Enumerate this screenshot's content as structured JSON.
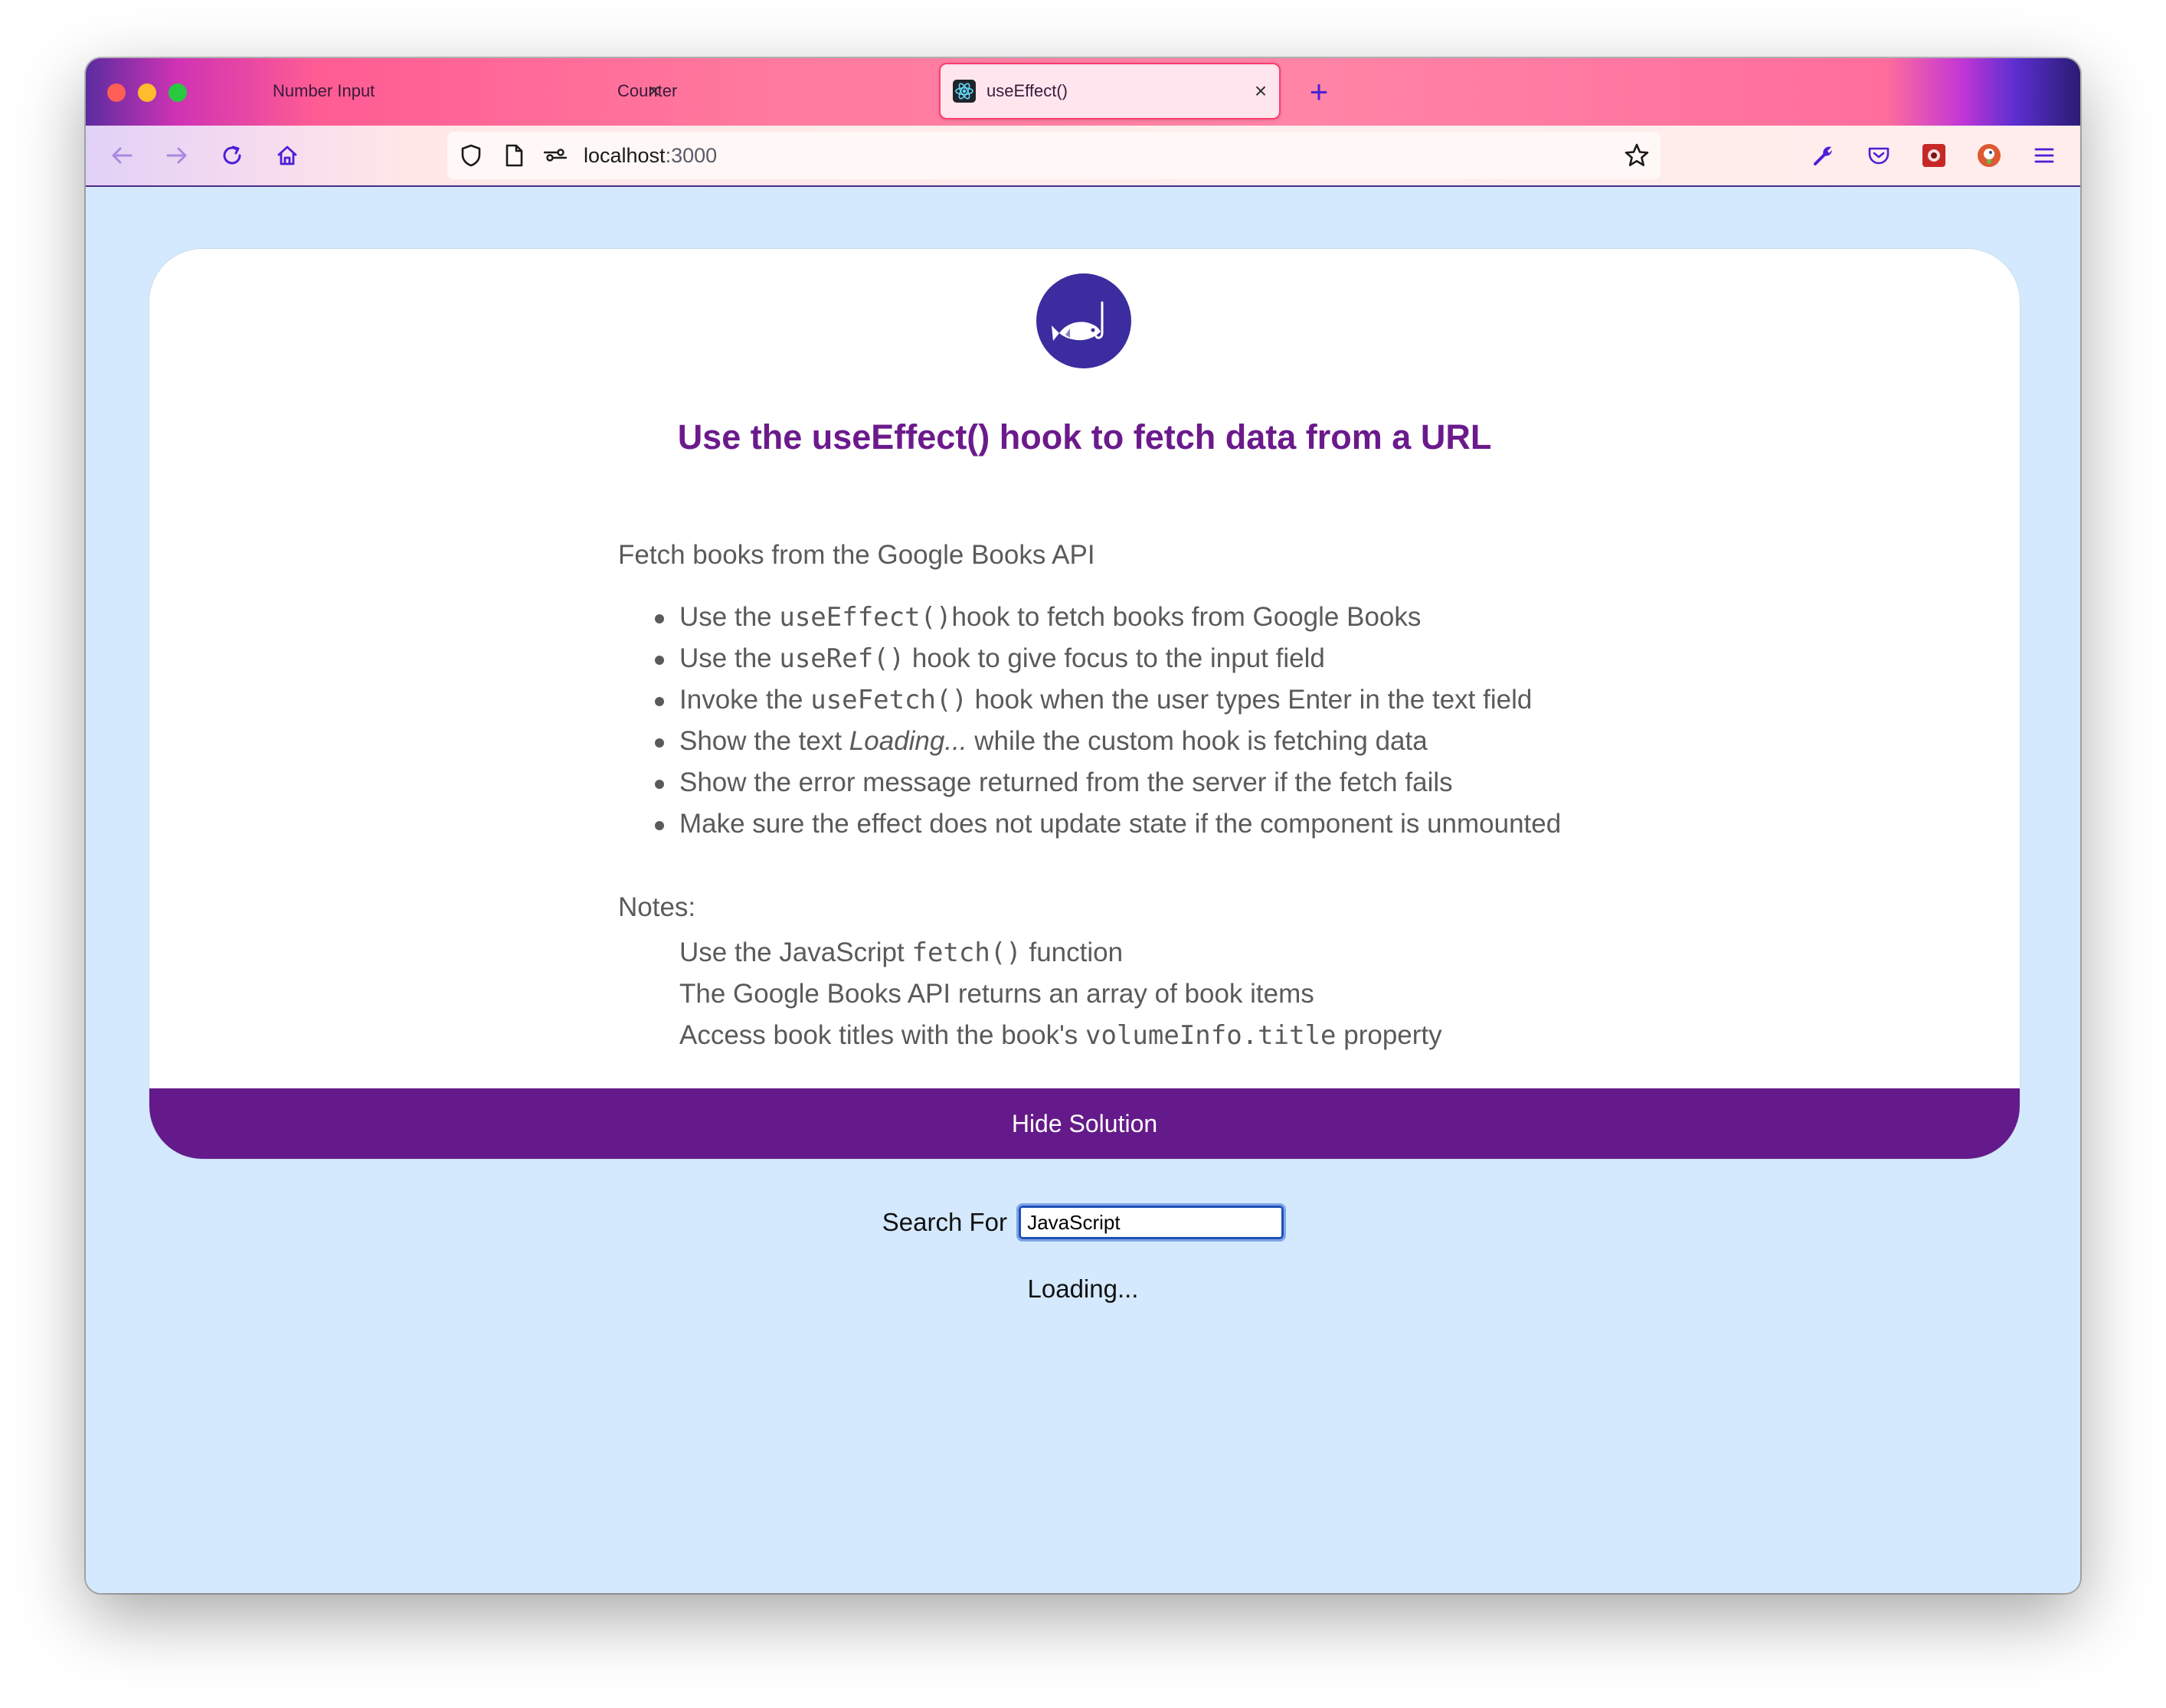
{
  "browser": {
    "tabs": [
      {
        "label": "Number Input",
        "active": false
      },
      {
        "label": "Counter",
        "active": false
      },
      {
        "label": "useEffect()",
        "active": true
      }
    ],
    "url_host": "localhost",
    "url_port": ":3000"
  },
  "page": {
    "title": "Use the useEffect() hook to fetch data from a URL",
    "intro": "Fetch books from the Google Books API",
    "bullets": [
      {
        "pre": "Use the ",
        "code": "useEffect()",
        "post": "hook to fetch books from Google Books"
      },
      {
        "pre": "Use the ",
        "code": "useRef()",
        "post": " hook to give focus to the input field"
      },
      {
        "pre": "Invoke the ",
        "code": "useFetch()",
        "post": " hook when the user types Enter in the text field"
      },
      {
        "pre": "Show the text ",
        "em": "Loading...",
        "post": " while the custom hook is fetching data"
      },
      {
        "pre": "Show the error message returned from the server if the fetch fails"
      },
      {
        "pre": "Make sure the effect does not update state if the component is unmounted"
      }
    ],
    "notes_label": "Notes:",
    "notes": [
      {
        "pre": "Use the JavaScript ",
        "code": "fetch()",
        "post": " function"
      },
      {
        "pre": "The Google Books API returns an array of book items"
      },
      {
        "pre": "Access book titles with the book's ",
        "code": "volumeInfo.title",
        "post": " property"
      }
    ],
    "solution_button": "Hide Solution",
    "search_label": "Search For",
    "search_value": "JavaScript",
    "loading_text": "Loading..."
  },
  "colors": {
    "page_background": "#d4e9fd",
    "title": "#6b1a8c",
    "solution_bar": "#641a8a",
    "logo": "#3b2da0"
  },
  "icons": [
    "back-arrow-icon",
    "forward-arrow-icon",
    "reload-icon",
    "home-icon",
    "shield-icon",
    "page-icon",
    "permissions-icon",
    "bookmark-star-icon",
    "wrench-icon",
    "pocket-icon",
    "extension-icon",
    "duckduckgo-icon",
    "menu-icon",
    "react-icon",
    "fish-logo-icon"
  ]
}
